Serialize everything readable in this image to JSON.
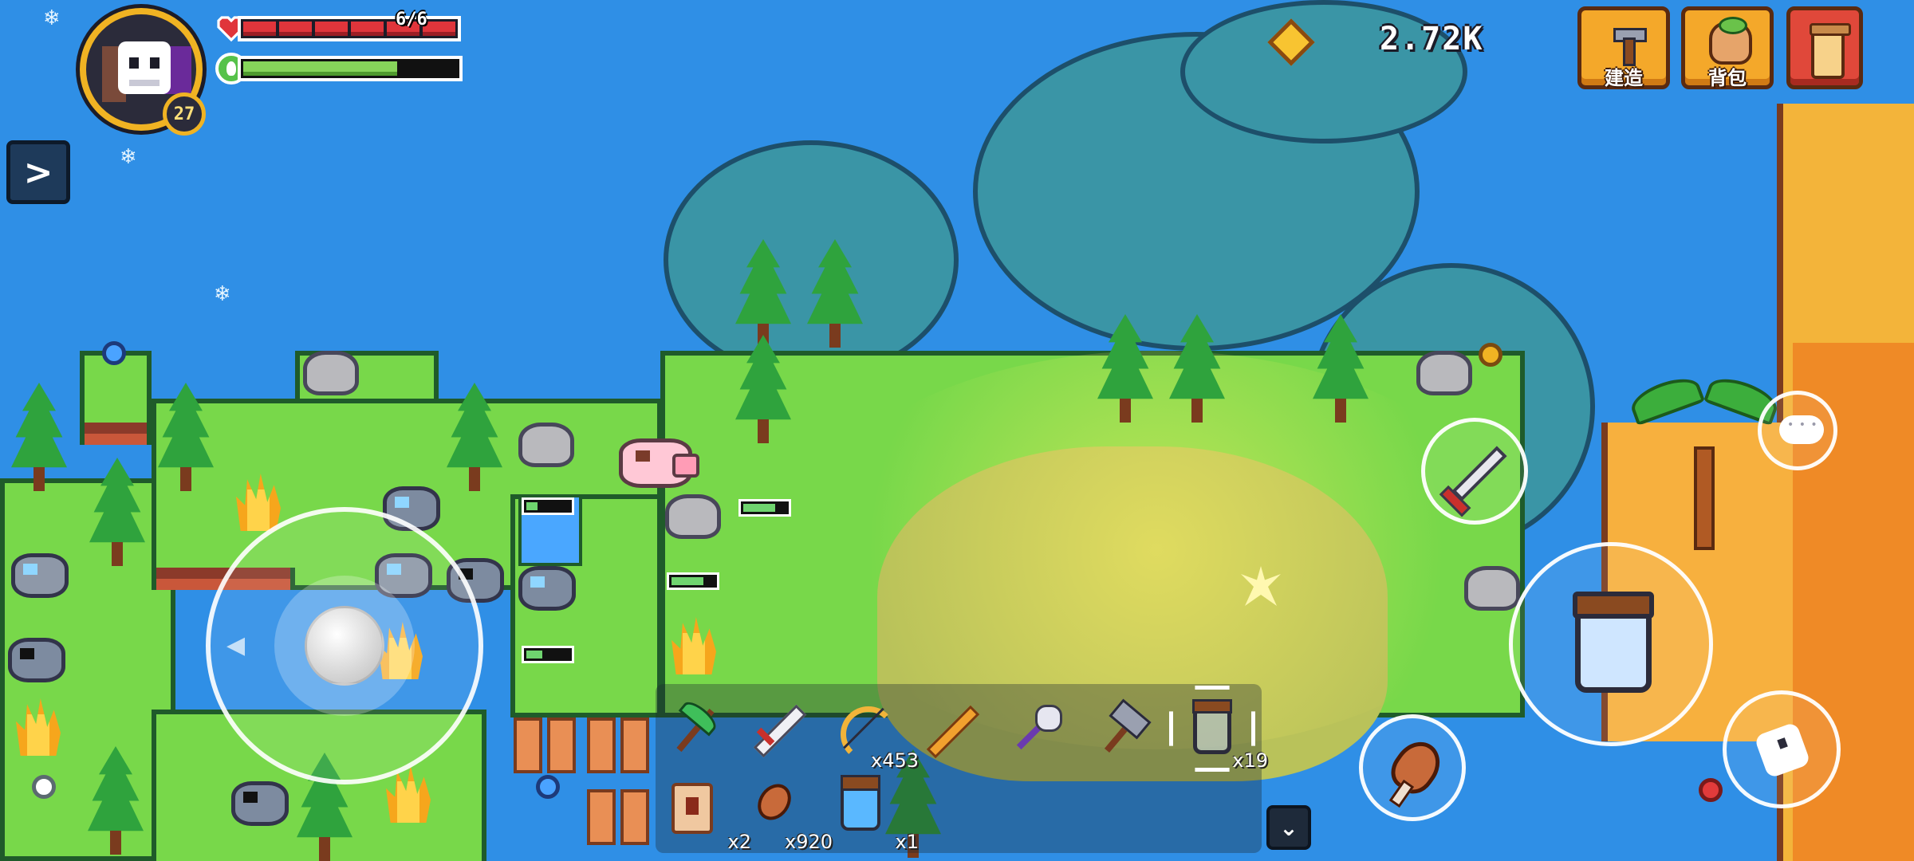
{
  "player": {
    "level": "27",
    "hp_text": "6/6",
    "hp_segments": 6,
    "energy_level": 0.72
  },
  "currency": {
    "amount": "2.72K",
    "icon": "gem-icon"
  },
  "top_buttons": [
    {
      "label": "建造",
      "icon": "build-icon"
    },
    {
      "label": "背包",
      "icon": "backpack-icon"
    },
    {
      "label": "",
      "icon": "scroll-icon"
    }
  ],
  "side_toggle": {
    "glyph": ">"
  },
  "hotbar": {
    "row1": [
      {
        "icon": "pickaxe-icon",
        "count": ""
      },
      {
        "icon": "sword-icon",
        "count": ""
      },
      {
        "icon": "bow-icon",
        "count": "x453"
      },
      {
        "icon": "golden-sword-icon",
        "count": ""
      },
      {
        "icon": "skull-staff-icon",
        "count": ""
      },
      {
        "icon": "hammer-icon",
        "count": ""
      },
      {
        "icon": "jar-icon",
        "count": "x19",
        "selected": true
      }
    ],
    "row2": [
      {
        "icon": "scroll-item-icon",
        "count": "x2"
      },
      {
        "icon": "meat-icon",
        "count": "x920"
      },
      {
        "icon": "bottle-icon",
        "count": "x1"
      }
    ],
    "expand_glyph": "⌄"
  },
  "actions": {
    "attack": "sword-icon",
    "use": "jar-icon",
    "eat": "meat-icon",
    "dash": "dash-icon",
    "chat": "chat-icon"
  },
  "colors": {
    "sea": "#2f8fe6",
    "grass": "#78d84a",
    "hp": "#e0353b",
    "energy": "#86d45a",
    "gold": "#f0b323"
  }
}
